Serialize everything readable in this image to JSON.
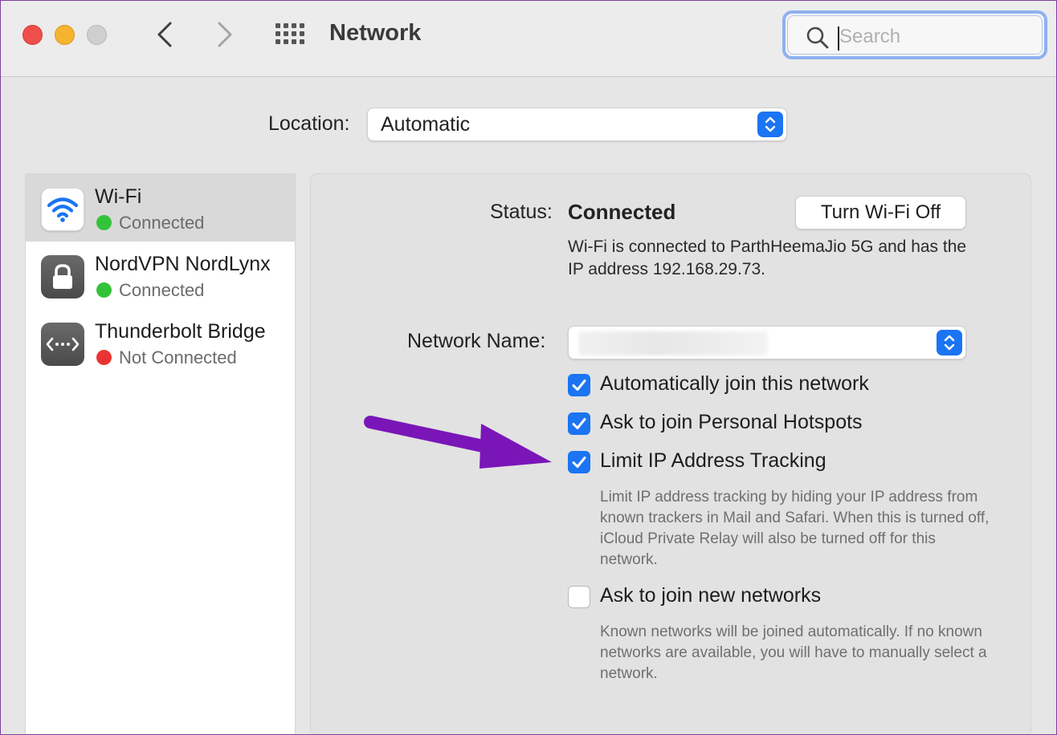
{
  "window": {
    "title": "Network",
    "search": {
      "placeholder": "Search",
      "value": ""
    }
  },
  "location": {
    "label": "Location:",
    "value": "Automatic"
  },
  "sidebar": {
    "items": [
      {
        "name": "Wi-Fi",
        "status": "Connected",
        "status_color": "#33c33a",
        "icon": "wifi-icon",
        "selected": true
      },
      {
        "name": "NordVPN NordLynx",
        "status": "Connected",
        "status_color": "#33c33a",
        "icon": "lock-icon",
        "selected": false
      },
      {
        "name": "Thunderbolt Bridge",
        "status": "Not Connected",
        "status_color": "#ea3434",
        "icon": "thunderbolt-bridge-icon",
        "selected": false
      }
    ]
  },
  "detail": {
    "status_label": "Status:",
    "status_value": "Connected",
    "toggle_button": "Turn Wi-Fi Off",
    "description": "Wi-Fi is connected to ParthHeemaJio 5G and has the IP address 192.168.29.73.",
    "network_name_label": "Network Name:",
    "options": [
      {
        "label": "Automatically join this network",
        "checked": true
      },
      {
        "label": "Ask to join Personal Hotspots",
        "checked": true
      },
      {
        "label": "Limit IP Address Tracking",
        "checked": true,
        "help": "Limit IP address tracking by hiding your IP address from known trackers in Mail and Safari. When this is turned off, iCloud Private Relay will also be turned off for this network."
      },
      {
        "label": "Ask to join new networks",
        "checked": false,
        "help": "Known networks will be joined automatically. If no known networks are available, you will have to manually select a network."
      }
    ]
  },
  "colors": {
    "accent": "#1b74f2",
    "annotation_arrow": "#7a16b8"
  }
}
